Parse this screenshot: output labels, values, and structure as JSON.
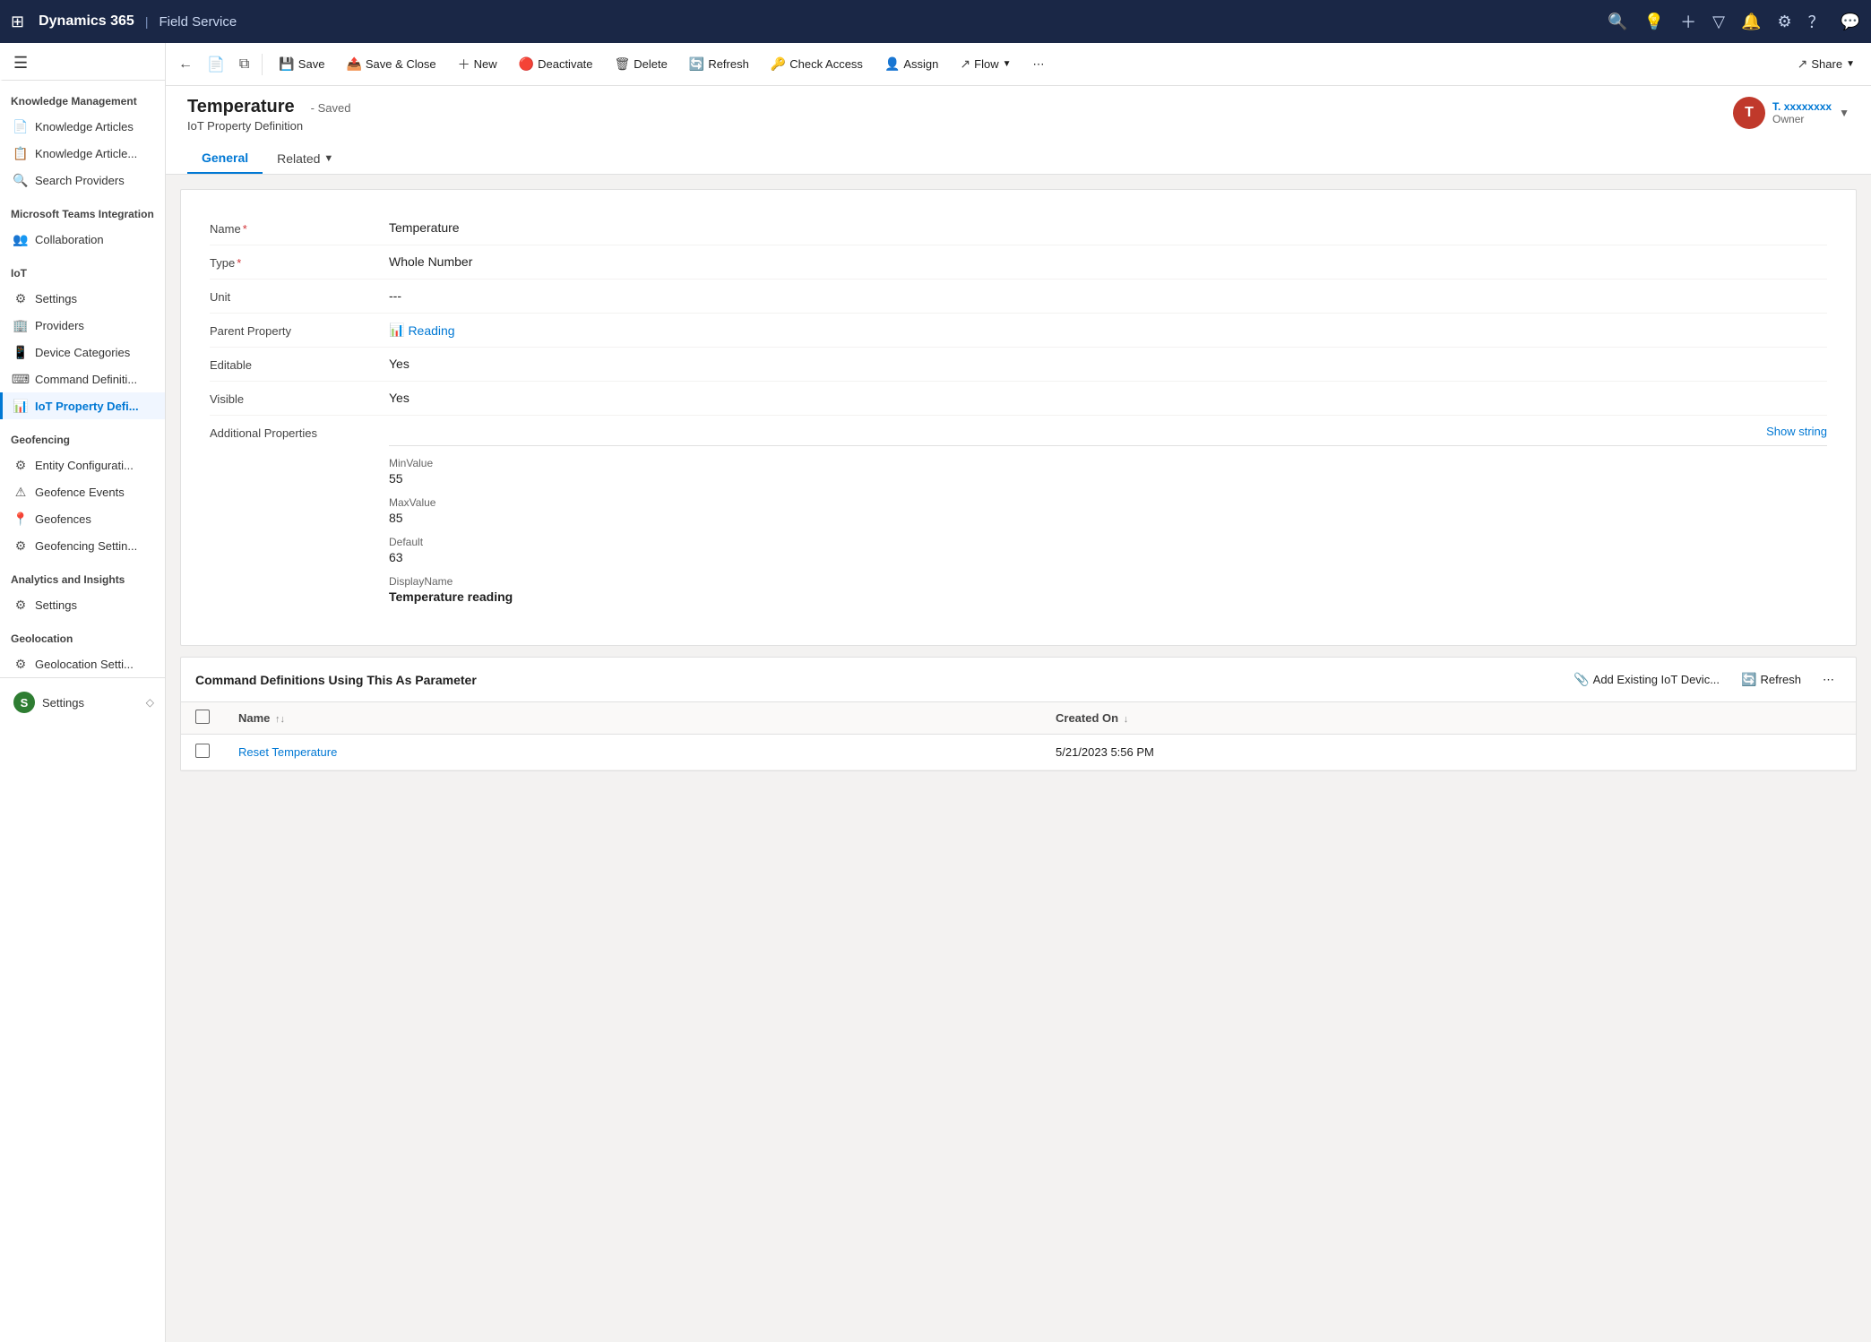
{
  "topNav": {
    "waffle": "⊞",
    "appTitle": "Dynamics 365",
    "divider": "|",
    "module": "Field Service",
    "icons": [
      "search",
      "lightbulb",
      "plus",
      "filter",
      "bell",
      "gear",
      "question",
      "chat"
    ]
  },
  "sidebar": {
    "sections": [
      {
        "header": "Knowledge Management",
        "items": [
          {
            "id": "knowledge-articles",
            "label": "Knowledge Articles",
            "icon": "📄",
            "active": false
          },
          {
            "id": "knowledge-articles-2",
            "label": "Knowledge Article...",
            "icon": "📋",
            "active": false
          },
          {
            "id": "search-providers",
            "label": "Search Providers",
            "icon": "🔍",
            "active": false
          }
        ]
      },
      {
        "header": "Microsoft Teams Integration",
        "items": [
          {
            "id": "collaboration",
            "label": "Collaboration",
            "icon": "👥",
            "active": false
          }
        ]
      },
      {
        "header": "IoT",
        "items": [
          {
            "id": "settings",
            "label": "Settings",
            "icon": "⚙",
            "active": false
          },
          {
            "id": "providers",
            "label": "Providers",
            "icon": "🏢",
            "active": false
          },
          {
            "id": "device-categories",
            "label": "Device Categories",
            "icon": "📱",
            "active": false
          },
          {
            "id": "command-definitions",
            "label": "Command Definiti...",
            "icon": "⌨",
            "active": false
          },
          {
            "id": "iot-property-def",
            "label": "IoT Property Defi...",
            "icon": "📊",
            "active": true
          }
        ]
      },
      {
        "header": "Geofencing",
        "items": [
          {
            "id": "entity-configuration",
            "label": "Entity Configurati...",
            "icon": "⚙",
            "active": false
          },
          {
            "id": "geofence-events",
            "label": "Geofence Events",
            "icon": "⚠",
            "active": false
          },
          {
            "id": "geofences",
            "label": "Geofences",
            "icon": "📍",
            "active": false
          },
          {
            "id": "geofencing-settings",
            "label": "Geofencing Settin...",
            "icon": "⚙",
            "active": false
          }
        ]
      },
      {
        "header": "Analytics and Insights",
        "items": [
          {
            "id": "analytics-settings",
            "label": "Settings",
            "icon": "⚙",
            "active": false
          }
        ]
      },
      {
        "header": "Geolocation",
        "items": [
          {
            "id": "geolocation-settings",
            "label": "Geolocation Setti...",
            "icon": "⚙",
            "active": false
          }
        ]
      }
    ],
    "bottom": [
      {
        "id": "settings-bottom",
        "label": "Settings",
        "icon": "S",
        "active": false
      }
    ]
  },
  "commandBar": {
    "backLabel": "←",
    "pageIcon": "📄",
    "splitIcon": "⧉",
    "save": "Save",
    "saveClose": "Save & Close",
    "new": "New",
    "deactivate": "Deactivate",
    "delete": "Delete",
    "refresh": "Refresh",
    "checkAccess": "Check Access",
    "assign": "Assign",
    "flow": "Flow",
    "more": "⋯",
    "share": "Share"
  },
  "record": {
    "title": "Temperature",
    "savedStatus": "- Saved",
    "subtitle": "IoT Property Definition",
    "ownerInitial": "T",
    "ownerName": "T. xxxxxxxx",
    "ownerLabel": "Owner"
  },
  "tabs": {
    "general": "General",
    "related": "Related"
  },
  "form": {
    "fields": [
      {
        "label": "Name",
        "required": true,
        "value": "Temperature",
        "type": "text"
      },
      {
        "label": "Type",
        "required": true,
        "value": "Whole Number",
        "type": "text"
      },
      {
        "label": "Unit",
        "required": false,
        "value": "---",
        "type": "text"
      },
      {
        "label": "Parent Property",
        "required": false,
        "value": "Reading",
        "type": "link",
        "icon": "📊"
      },
      {
        "label": "Editable",
        "required": false,
        "value": "Yes",
        "type": "text"
      },
      {
        "label": "Visible",
        "required": false,
        "value": "Yes",
        "type": "text"
      }
    ],
    "additionalProperties": {
      "label": "Additional Properties",
      "showStringLabel": "Show string",
      "props": [
        {
          "label": "MinValue",
          "value": "55"
        },
        {
          "label": "MaxValue",
          "value": "85"
        },
        {
          "label": "Default",
          "value": "63"
        },
        {
          "label": "DisplayName",
          "value": "Temperature reading",
          "bold": true
        }
      ]
    }
  },
  "subgrid": {
    "title": "Command Definitions Using This As Parameter",
    "addExisting": "Add Existing IoT Devic...",
    "refresh": "Refresh",
    "more": "⋯",
    "columns": [
      {
        "label": "Name",
        "sortable": true,
        "sort": "↑↓"
      },
      {
        "label": "Created On",
        "sortable": true,
        "sort": "↓"
      }
    ],
    "rows": [
      {
        "name": "Reset Temperature",
        "createdOn": "5/21/2023 5:56 PM"
      }
    ]
  }
}
